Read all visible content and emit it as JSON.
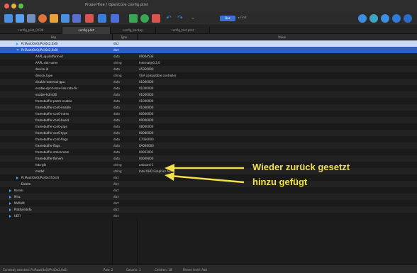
{
  "window": {
    "title": "ProperTree / OpenCore config.plist"
  },
  "toolbar": {
    "badge": "Bas",
    "find_label": "▸ Find",
    "colors": {
      "accent": "#3d6fd4"
    }
  },
  "tabs": [
    {
      "label": "config_plist_OC06",
      "active": false
    },
    {
      "label": "config.plist",
      "active": true
    },
    {
      "label": "config_backup",
      "active": false
    },
    {
      "label": "config_test.plist",
      "active": false
    }
  ],
  "header": {
    "key": "Key",
    "type": "Type",
    "value": "Value"
  },
  "rows": [
    {
      "key": "PciRoot(0x0)/Pci(0x2,0x0)",
      "type": "dict",
      "value": "",
      "indent": 1,
      "expander": "right",
      "sel": "light"
    },
    {
      "key": "PciRoot(0x0)/Pci(0x2,0x0)",
      "type": "dict",
      "value": "",
      "indent": 1,
      "expander": "down",
      "sel": "blue"
    },
    {
      "key": "AAPL,ig-platform-id",
      "type": "data",
      "value": "0900A53E",
      "indent": 3
    },
    {
      "key": "AAPL,slot-name",
      "type": "string",
      "value": "Internal@0,2,0",
      "indent": 3
    },
    {
      "key": "device-id",
      "type": "data",
      "value": "A53E0000",
      "indent": 3
    },
    {
      "key": "device_type",
      "type": "string",
      "value": "VGA compatible controller",
      "indent": 3
    },
    {
      "key": "disable-external-gpu",
      "type": "data",
      "value": "01000000",
      "indent": 3
    },
    {
      "key": "enable-dpcd-max-link-rate-fix",
      "type": "data",
      "value": "01000000",
      "indent": 3
    },
    {
      "key": "enable-hdmi20",
      "type": "data",
      "value": "01000000",
      "indent": 3
    },
    {
      "key": "framebuffer-patch-enable",
      "type": "data",
      "value": "01000000",
      "indent": 3
    },
    {
      "key": "framebuffer-con0-enable",
      "type": "data",
      "value": "01000000",
      "indent": 3
    },
    {
      "key": "framebuffer-con0-index",
      "type": "data",
      "value": "00000000",
      "indent": 3
    },
    {
      "key": "framebuffer-con0-busid",
      "type": "data",
      "value": "00000000",
      "indent": 3
    },
    {
      "key": "framebuffer-con0-pipe",
      "type": "data",
      "value": "08000000",
      "indent": 3
    },
    {
      "key": "framebuffer-con0-type",
      "type": "data",
      "value": "00080000",
      "indent": 3
    },
    {
      "key": "framebuffer-con0-flags",
      "type": "data",
      "value": "C7030000",
      "indent": 3
    },
    {
      "key": "framebuffer-flags",
      "type": "data",
      "value": "0A0B0000",
      "indent": 3
    },
    {
      "key": "framebuffer-stolenmem",
      "type": "data",
      "value": "00003001",
      "indent": 3
    },
    {
      "key": "framebuffer-fbmem",
      "type": "data",
      "value": "00009000",
      "indent": 3
    },
    {
      "key": "hda-gfx",
      "type": "string",
      "value": "onboard-1",
      "indent": 3
    },
    {
      "key": "model",
      "type": "string",
      "value": "Intel UHD Graphics 630",
      "indent": 3
    },
    {
      "key": "PciRoot(0x0)/Pci(0x1f,0x3)",
      "type": "dict",
      "value": "",
      "indent": 1,
      "expander": "right"
    },
    {
      "key": "Delete",
      "type": "dict",
      "value": "",
      "indent": 1
    },
    {
      "key": "Kernel",
      "type": "dict",
      "value": "",
      "indent": 0,
      "expander": "right"
    },
    {
      "key": "Misc",
      "type": "dict",
      "value": "",
      "indent": 0,
      "expander": "right"
    },
    {
      "key": "NVRAM",
      "type": "dict",
      "value": "",
      "indent": 0,
      "expander": "right"
    },
    {
      "key": "PlatformInfo",
      "type": "dict",
      "value": "",
      "indent": 0,
      "expander": "right"
    },
    {
      "key": "UEFI",
      "type": "dict",
      "value": "",
      "indent": 0,
      "expander": "right"
    }
  ],
  "annotations": {
    "reset_label": "Wieder zurück gesetzt",
    "added_label": "hinzu gefügt",
    "color": "#f3e04a"
  },
  "statusbar": {
    "selected": "Currently selected: PciRoot(0x0)/Pci(0x2,0x0)",
    "row": "Row: 2",
    "column": "Column: 1",
    "children": "Children: 18",
    "parent": "Parent level: Add"
  }
}
